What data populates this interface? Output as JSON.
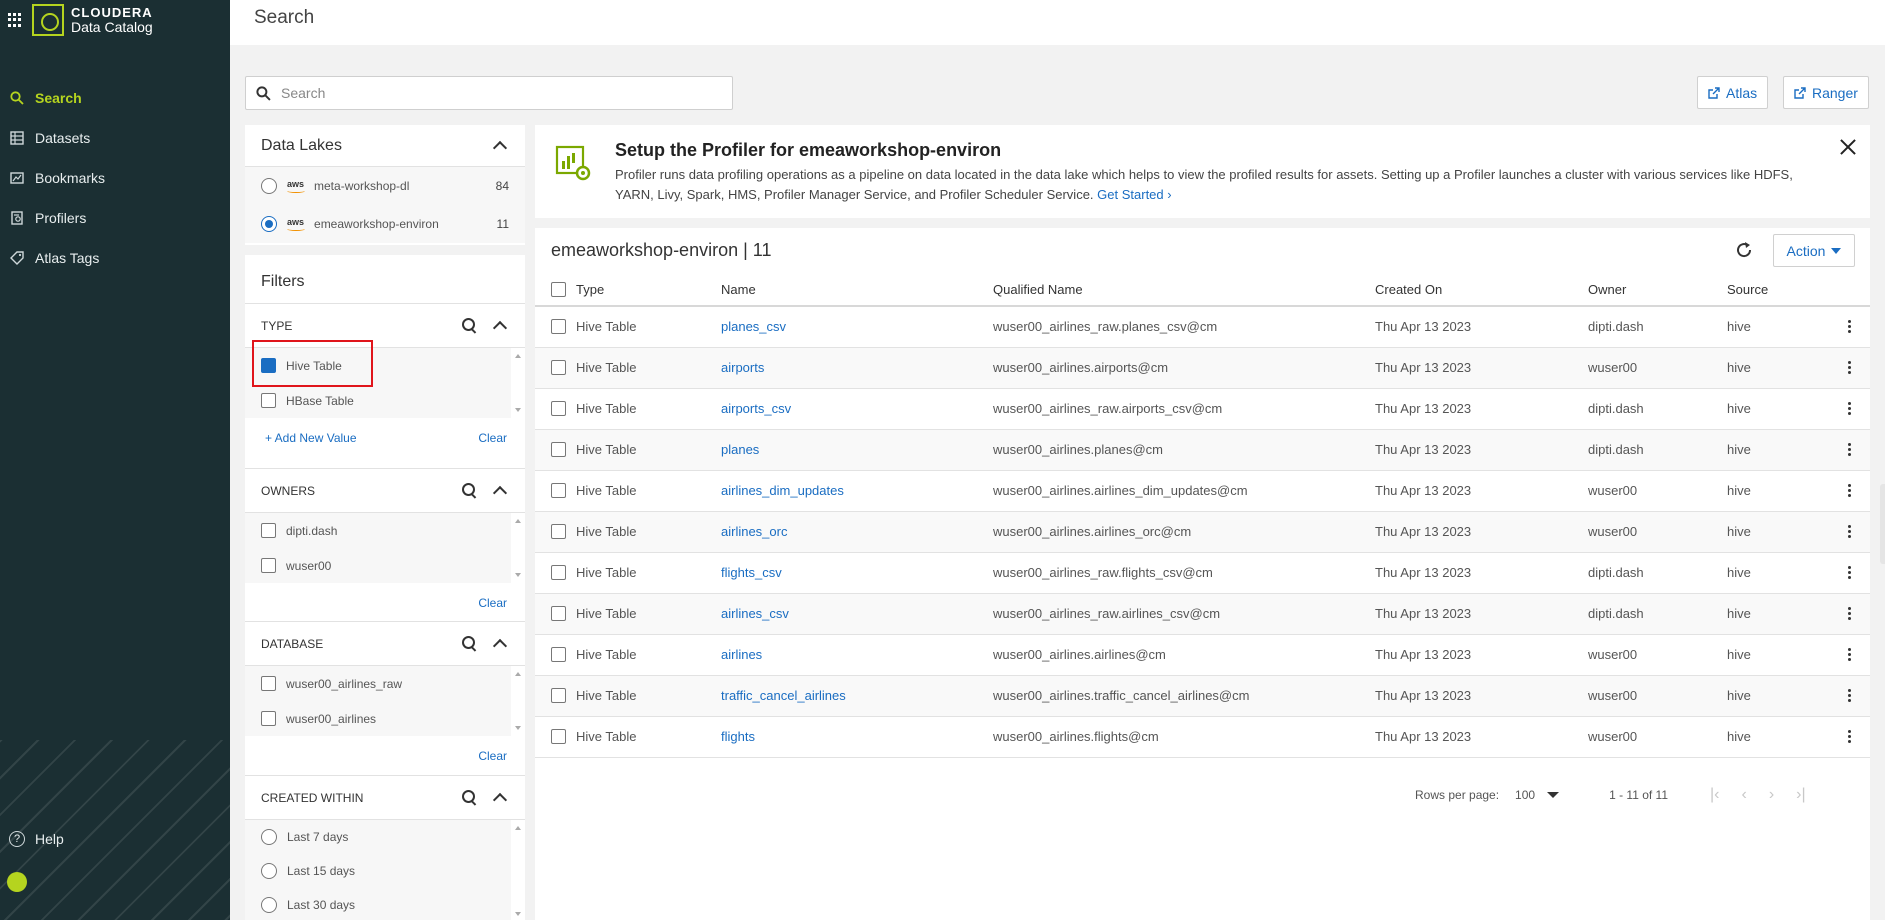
{
  "brand": {
    "line1": "CLOUDERA",
    "line2": "Data Catalog"
  },
  "nav": [
    {
      "label": "Search",
      "icon": "search-icon",
      "active": true
    },
    {
      "label": "Datasets",
      "icon": "datasets-icon"
    },
    {
      "label": "Bookmarks",
      "icon": "bookmarks-icon"
    },
    {
      "label": "Profilers",
      "icon": "profilers-icon"
    },
    {
      "label": "Atlas Tags",
      "icon": "tag-icon"
    }
  ],
  "help_label": "Help",
  "header": {
    "title": "Search"
  },
  "search": {
    "placeholder": "Search"
  },
  "ext_links": {
    "atlas": "Atlas",
    "ranger": "Ranger"
  },
  "data_lakes": {
    "title": "Data Lakes",
    "provider_label": "aws",
    "items": [
      {
        "name": "meta-workshop-dl",
        "count": "84",
        "selected": false
      },
      {
        "name": "emeaworkshop-environ",
        "count": "11",
        "selected": true
      }
    ]
  },
  "filters": {
    "title": "Filters",
    "add_value": "+ Add New Value",
    "clear": "Clear",
    "type": {
      "title": "TYPE",
      "options": [
        "Hive Table",
        "HBase Table"
      ],
      "checked": [
        true,
        false
      ]
    },
    "owners": {
      "title": "OWNERS",
      "options": [
        "dipti.dash",
        "wuser00"
      ]
    },
    "database": {
      "title": "DATABASE",
      "options": [
        "wuser00_airlines_raw",
        "wuser00_airlines"
      ]
    },
    "created_within": {
      "title": "CREATED WITHIN",
      "options": [
        "Last 7 days",
        "Last 15 days",
        "Last 30 days"
      ]
    }
  },
  "banner": {
    "title": "Setup the Profiler for emeaworkshop-environ",
    "text": "Profiler runs data profiling operations as a pipeline on data located in the data lake which helps to view the profiled results for assets. Setting up a Profiler launches a cluster with various services like HDFS, YARN, Livy, Spark, HMS, Profiler Manager Service, and Profiler Scheduler Service.",
    "link": "Get Started"
  },
  "results": {
    "title": "emeaworkshop-environ | 11",
    "action_label": "Action",
    "columns": [
      "Type",
      "Name",
      "Qualified Name",
      "Created On",
      "Owner",
      "Source"
    ],
    "rows": [
      {
        "type": "Hive Table",
        "name": "planes_csv",
        "qualified": "wuser00_airlines_raw.planes_csv@cm",
        "created": "Thu Apr 13 2023",
        "owner": "dipti.dash",
        "source": "hive"
      },
      {
        "type": "Hive Table",
        "name": "airports",
        "qualified": "wuser00_airlines.airports@cm",
        "created": "Thu Apr 13 2023",
        "owner": "wuser00",
        "source": "hive"
      },
      {
        "type": "Hive Table",
        "name": "airports_csv",
        "qualified": "wuser00_airlines_raw.airports_csv@cm",
        "created": "Thu Apr 13 2023",
        "owner": "dipti.dash",
        "source": "hive"
      },
      {
        "type": "Hive Table",
        "name": "planes",
        "qualified": "wuser00_airlines.planes@cm",
        "created": "Thu Apr 13 2023",
        "owner": "dipti.dash",
        "source": "hive"
      },
      {
        "type": "Hive Table",
        "name": "airlines_dim_updates",
        "qualified": "wuser00_airlines.airlines_dim_updates@cm",
        "created": "Thu Apr 13 2023",
        "owner": "wuser00",
        "source": "hive"
      },
      {
        "type": "Hive Table",
        "name": "airlines_orc",
        "qualified": "wuser00_airlines.airlines_orc@cm",
        "created": "Thu Apr 13 2023",
        "owner": "wuser00",
        "source": "hive"
      },
      {
        "type": "Hive Table",
        "name": "flights_csv",
        "qualified": "wuser00_airlines_raw.flights_csv@cm",
        "created": "Thu Apr 13 2023",
        "owner": "dipti.dash",
        "source": "hive"
      },
      {
        "type": "Hive Table",
        "name": "airlines_csv",
        "qualified": "wuser00_airlines_raw.airlines_csv@cm",
        "created": "Thu Apr 13 2023",
        "owner": "dipti.dash",
        "source": "hive"
      },
      {
        "type": "Hive Table",
        "name": "airlines",
        "qualified": "wuser00_airlines.airlines@cm",
        "created": "Thu Apr 13 2023",
        "owner": "wuser00",
        "source": "hive"
      },
      {
        "type": "Hive Table",
        "name": "traffic_cancel_airlines",
        "qualified": "wuser00_airlines.traffic_cancel_airlines@cm",
        "created": "Thu Apr 13 2023",
        "owner": "wuser00",
        "source": "hive"
      },
      {
        "type": "Hive Table",
        "name": "flights",
        "qualified": "wuser00_airlines.flights@cm",
        "created": "Thu Apr 13 2023",
        "owner": "wuser00",
        "source": "hive"
      }
    ]
  },
  "pagination": {
    "rows_per_page_label": "Rows per page:",
    "rows_per_page": "100",
    "range": "1 - 11 of 11"
  },
  "colors": {
    "sidebar": "#1b2f33",
    "accent": "#b5d41f",
    "link": "#1a6dc2",
    "highlight": "#e0151b"
  }
}
